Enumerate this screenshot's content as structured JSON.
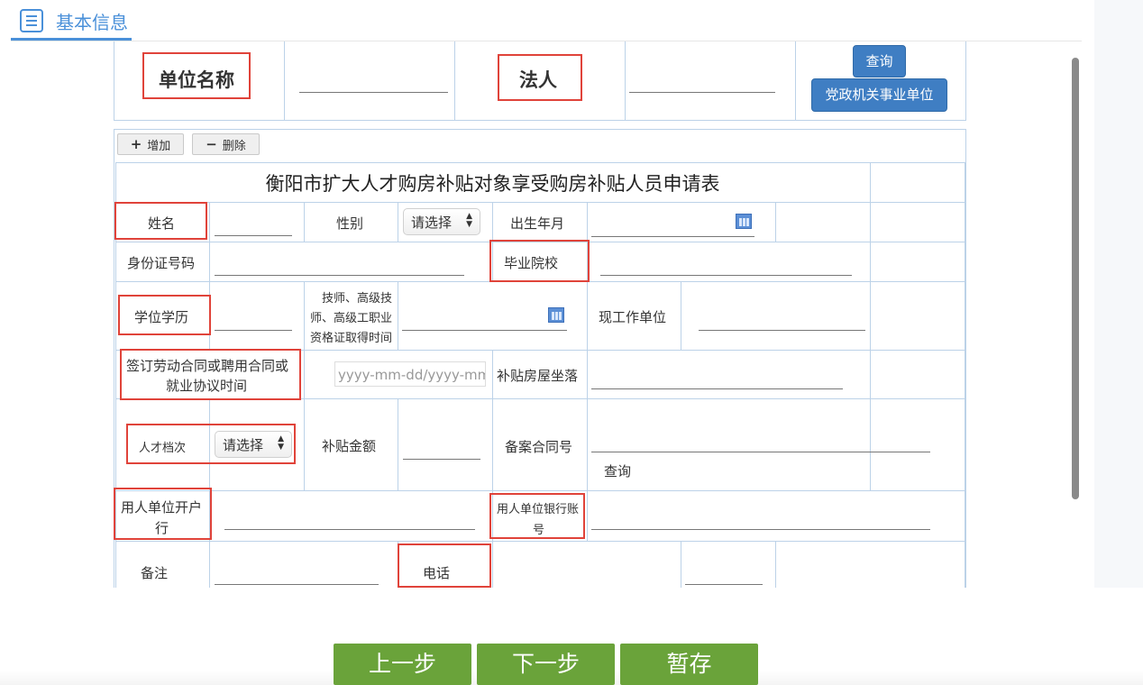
{
  "header": {
    "title": "基本信息"
  },
  "top_form": {
    "unit_name_label": "单位名称",
    "legal_person_label": "法人",
    "query_button": "查询",
    "party_gov_button": "党政机关事业单位"
  },
  "toolbar": {
    "add_label": "增加",
    "delete_label": "删除"
  },
  "table": {
    "title": "衡阳市扩大人才购房补贴对象享受购房补贴人员申请表",
    "name_label": "姓名",
    "gender_label": "性别",
    "gender_select": "请选择",
    "birth_label": "出生年月",
    "id_label": "身份证号码",
    "school_label": "毕业院校",
    "degree_label": "学位学历",
    "cert_time_label": [
      "技师、高级技",
      "师、高级工职业",
      "资格证取得时间"
    ],
    "work_unit_label": "现工作单位",
    "contract_time_label": [
      "签订劳动合同或聘用合同或",
      "就业协议时间"
    ],
    "contract_time_placeholder": "yyyy-mm-dd/yyyy-mm",
    "house_location_label": "补贴房屋坐落",
    "talent_level_label": "人才档次",
    "talent_level_select": "请选择",
    "subsidy_amount_label": "补贴金额",
    "filing_contract_label": "备案合同号",
    "filing_query_link": "查询",
    "employer_bank_label": [
      "用人单位开户",
      "行"
    ],
    "employer_account_label": [
      "用人单位银行账",
      "号"
    ],
    "remark_label": "备注",
    "phone_label": "电话"
  },
  "footer": {
    "prev_button": "上一步",
    "next_button": "下一步",
    "save_button": "暂存"
  },
  "colors": {
    "accent": "#4a90d9",
    "highlight": "#e0433a",
    "primary_button": "#3f7ec3",
    "nav_button": "#6aa33a"
  },
  "icons": [
    "list-icon",
    "plus-icon",
    "minus-icon",
    "calendar-icon",
    "sort-arrows-icon"
  ]
}
